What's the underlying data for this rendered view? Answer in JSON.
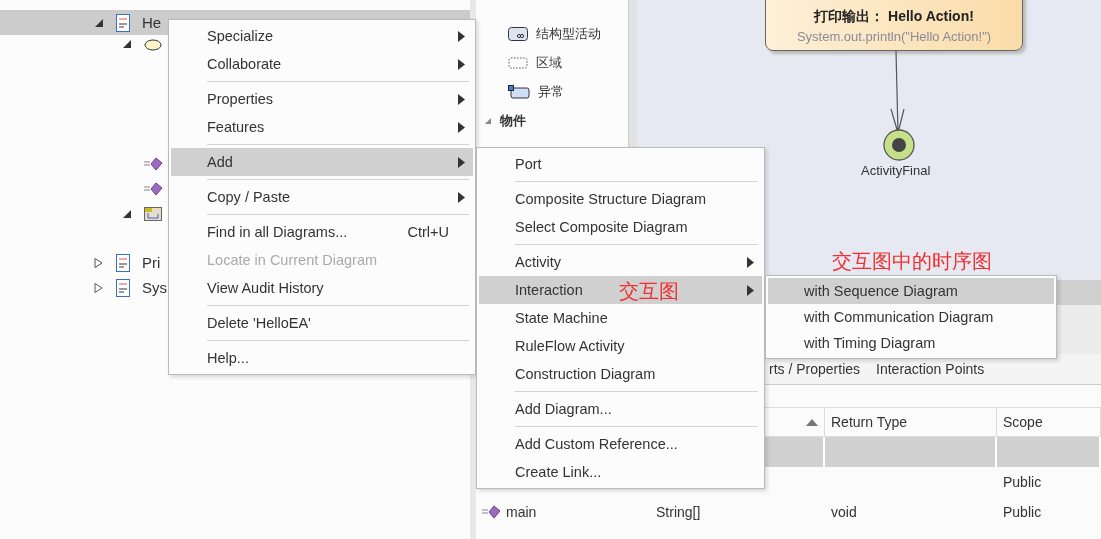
{
  "tree": [
    {
      "label": "He",
      "kind": "class",
      "expanded": true,
      "selected": true,
      "children": [
        {
          "kind": "oval",
          "expanded": true,
          "selected": false
        },
        {
          "kind": "method",
          "selected": false
        },
        {
          "kind": "method",
          "selected": false
        },
        {
          "kind": "diagram",
          "expanded": true,
          "selected": false
        }
      ]
    },
    {
      "label": "Pri",
      "kind": "class",
      "expanded": false,
      "selected": false
    },
    {
      "label": "Sys",
      "kind": "class",
      "expanded": false,
      "selected": false
    }
  ],
  "toolbox": {
    "items": [
      {
        "label": "结构型活动",
        "kind": "structured"
      },
      {
        "label": "区域",
        "kind": "region"
      },
      {
        "label": "异常",
        "kind": "exception"
      }
    ],
    "section": {
      "label": "物件",
      "expanded": true
    }
  },
  "diagram": {
    "action": {
      "title": "打印输出： **Hello Action!**",
      "code": "System.out.println(\"Hello Action!\")"
    },
    "final_node": {
      "label": "ActivityFinal"
    }
  },
  "annotations": [
    {
      "text": "交互图中的时序图"
    },
    {
      "text": "交互图"
    }
  ],
  "bottom_panel": {
    "tabs": [
      {
        "label": "rts / Properties",
        "selected": false
      },
      {
        "label": "Interaction Points",
        "selected": false
      }
    ],
    "table": {
      "columns": [
        {
          "sorted": true
        },
        {
          "label": "Return Type",
          "sorted": false
        },
        {
          "label": "Scope",
          "sorted": false
        }
      ],
      "rows": [
        {
          "kind": "blank",
          "selected": true
        },
        {
          "kind": "blank",
          "scope": "Public",
          "selected": false
        },
        {
          "kind": "method",
          "column_1": "main",
          "column_2": "String[]",
          "return_type": "void",
          "scope": "Public",
          "selected": false
        }
      ]
    }
  },
  "context_menu": [
    {
      "kind": "item",
      "label": "Specialize",
      "submenu": true,
      "disabled": false,
      "selected": false
    },
    {
      "kind": "item",
      "label": "Collaborate",
      "submenu": true,
      "disabled": false,
      "selected": false
    },
    {
      "kind": "separator"
    },
    {
      "kind": "item",
      "label": "Properties",
      "submenu": true,
      "disabled": false,
      "selected": false
    },
    {
      "kind": "item",
      "label": "Features",
      "submenu": true,
      "disabled": false,
      "selected": false
    },
    {
      "kind": "separator"
    },
    {
      "kind": "item",
      "label": "Add",
      "submenu": true,
      "disabled": false,
      "selected": true
    },
    {
      "kind": "separator"
    },
    {
      "kind": "item",
      "label": "Copy / Paste",
      "submenu": true,
      "disabled": false,
      "selected": false
    },
    {
      "kind": "separator"
    },
    {
      "kind": "item",
      "label": "Find in all Diagrams...",
      "shortcut": "Ctrl+U",
      "submenu": false,
      "disabled": false,
      "selected": false
    },
    {
      "kind": "item",
      "label": "Locate in Current Diagram",
      "submenu": false,
      "disabled": true,
      "selected": false
    },
    {
      "kind": "item",
      "label": "View Audit History",
      "submenu": false,
      "disabled": false,
      "selected": false
    },
    {
      "kind": "separator"
    },
    {
      "kind": "item",
      "label": "Delete 'HelloEA'",
      "submenu": false,
      "disabled": false,
      "selected": false
    },
    {
      "kind": "separator"
    },
    {
      "kind": "item",
      "label": "Help...",
      "submenu": false,
      "disabled": false,
      "selected": false
    }
  ],
  "add_menu": [
    {
      "kind": "item",
      "label": "Port",
      "submenu": false,
      "disabled": false,
      "selected": false
    },
    {
      "kind": "separator"
    },
    {
      "kind": "item",
      "label": "Composite Structure Diagram",
      "submenu": false,
      "disabled": false,
      "selected": false
    },
    {
      "kind": "item",
      "label": "Select Composite Diagram",
      "submenu": false,
      "disabled": false,
      "selected": false
    },
    {
      "kind": "separator"
    },
    {
      "kind": "item",
      "label": "Activity",
      "submenu": true,
      "disabled": false,
      "selected": false
    },
    {
      "kind": "item",
      "label": "Interaction",
      "submenu": true,
      "disabled": false,
      "selected": true
    },
    {
      "kind": "item",
      "label": "State Machine",
      "submenu": false,
      "disabled": false,
      "selected": false
    },
    {
      "kind": "item",
      "label": "RuleFlow Activity",
      "submenu": false,
      "disabled": false,
      "selected": false
    },
    {
      "kind": "item",
      "label": "Construction Diagram",
      "submenu": false,
      "disabled": false,
      "selected": false
    },
    {
      "kind": "separator"
    },
    {
      "kind": "item",
      "label": "Add Diagram...",
      "submenu": false,
      "disabled": false,
      "selected": false
    },
    {
      "kind": "separator"
    },
    {
      "kind": "item",
      "label": "Add Custom Reference...",
      "submenu": false,
      "disabled": false,
      "selected": false
    },
    {
      "kind": "item",
      "label": "Create Link...",
      "submenu": false,
      "disabled": false,
      "selected": false
    }
  ],
  "interaction_menu": [
    {
      "kind": "item",
      "label": "with Sequence Diagram",
      "submenu": false,
      "disabled": false,
      "selected": true
    },
    {
      "kind": "item",
      "label": "with Communication Diagram",
      "submenu": false,
      "disabled": false,
      "selected": false
    },
    {
      "kind": "item",
      "label": "with Timing Diagram",
      "submenu": false,
      "disabled": false,
      "selected": false
    }
  ]
}
